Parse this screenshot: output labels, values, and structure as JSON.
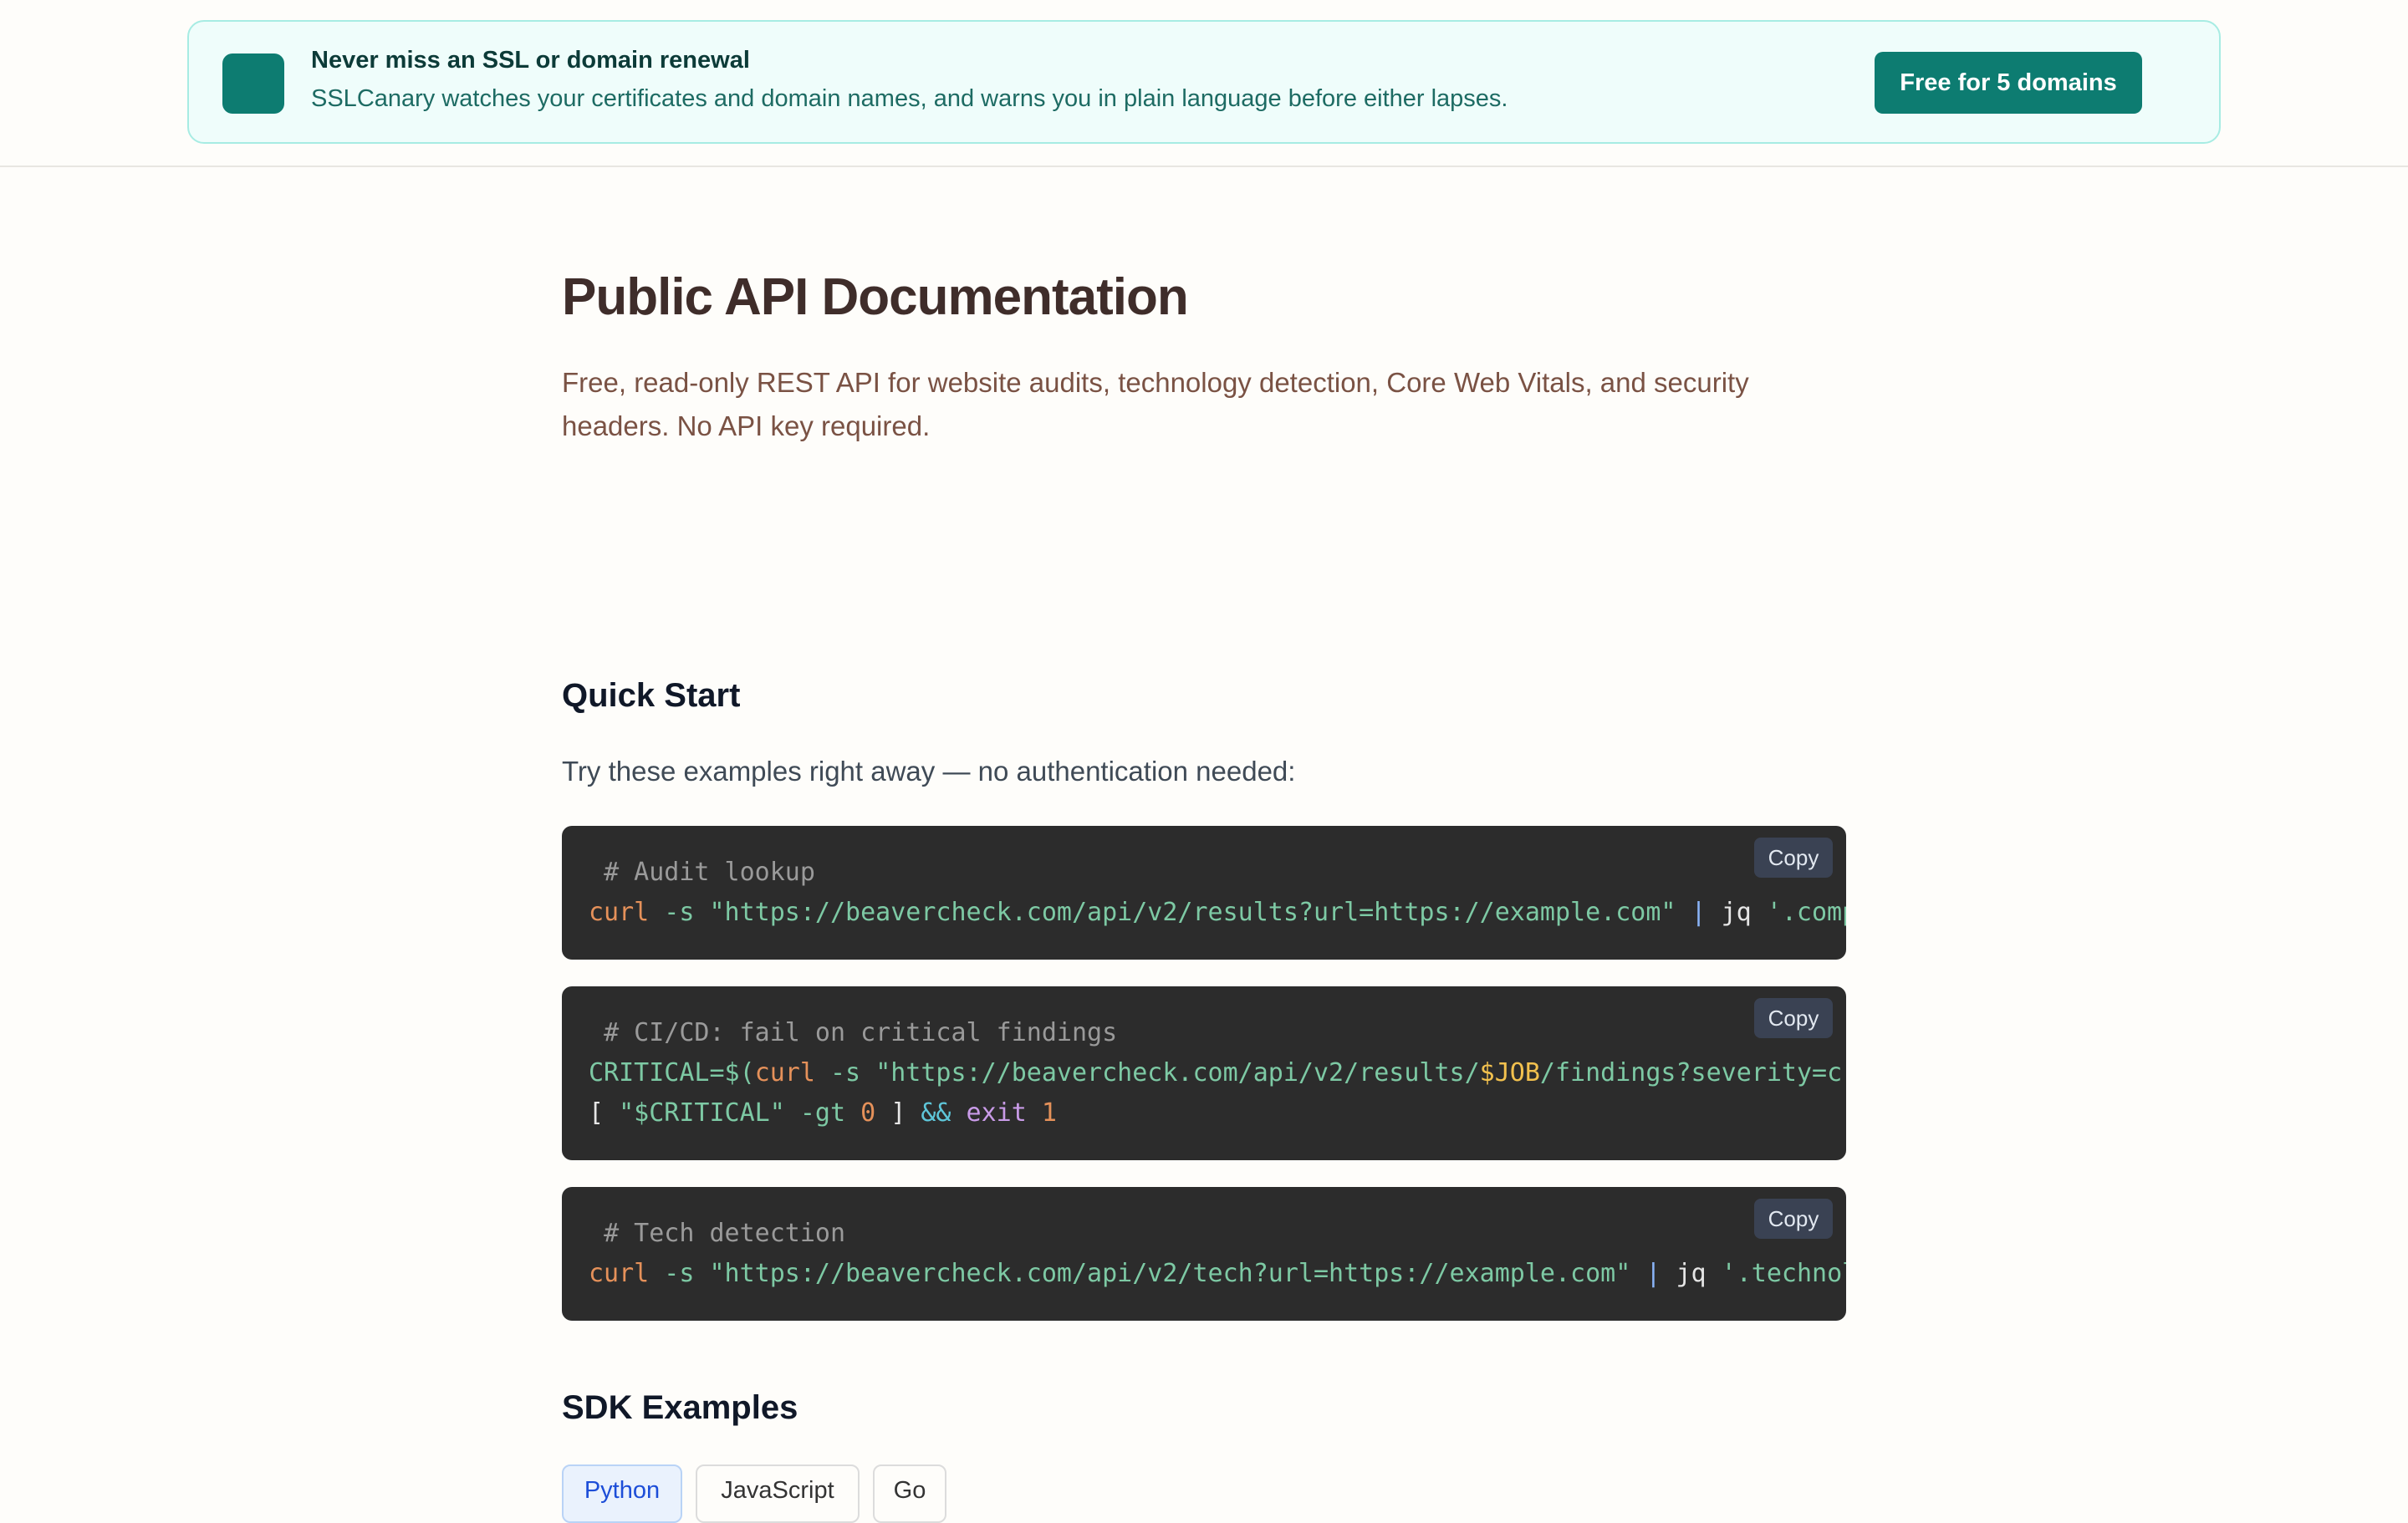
{
  "promo": {
    "title": "Never miss an SSL or domain renewal",
    "description": "SSLCanary watches your certificates and domain names, and warns you in plain language before either lapses.",
    "cta_label": "Free for 5 domains",
    "accent_color": "#0d7c71"
  },
  "page": {
    "title": "Public API Documentation",
    "intro": "Free, read-only REST API for website audits, technology detection, Core Web Vitals, and security headers. No API key required."
  },
  "quick_start": {
    "heading": "Quick Start",
    "intro": "Try these examples right away — no authentication needed:",
    "copy_label": "Copy",
    "examples": [
      {
        "comment": "# Audit lookup",
        "cmd": "curl",
        "flag": " -s ",
        "url": "\"https://beavercheck.com/api/v2/results?url=https://example.com\"",
        "pipe": " | ",
        "jq": "jq ",
        "filter": "'.composite'"
      },
      {
        "comment": "# CI/CD: fail on critical findings",
        "assign": "CRITICAL=$(",
        "cmd": "curl",
        "flag": " -s ",
        "url_start": "\"https://beavercheck.com/api/v2/results/",
        "var": "$JOB",
        "url_end": "/findings?severity=critical\"",
        "pipe": " | ",
        "line2_open": "[ ",
        "line2_var": "\"$CRITICAL\"",
        "line2_flag": " -gt ",
        "line2_num": "0",
        "line2_close": " ] ",
        "line2_and": "&&",
        "line2_exit": " exit ",
        "line2_code": "1"
      },
      {
        "comment": "# Tech detection",
        "cmd": "curl",
        "flag": " -s ",
        "url": "\"https://beavercheck.com/api/v2/tech?url=https://example.com\"",
        "pipe": " | ",
        "jq": "jq ",
        "filter": "'.technologies[].na"
      }
    ]
  },
  "sdk": {
    "heading": "SDK Examples",
    "tabs": [
      "Python",
      "JavaScript",
      "Go"
    ],
    "active_tab": "Python"
  }
}
